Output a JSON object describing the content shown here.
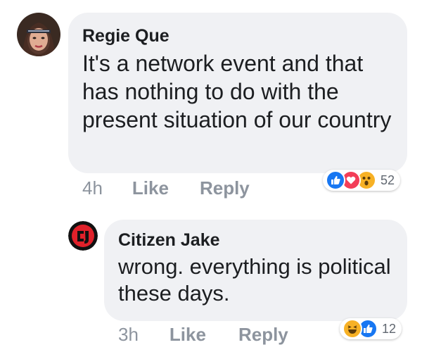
{
  "comments": [
    {
      "author": "Regie Que",
      "text": "It's a network event and  that has nothing to do with the present situation of our country",
      "time": "4h",
      "like_label": "Like",
      "reply_label": "Reply",
      "reactions": [
        "like-icon",
        "love-icon",
        "wow-icon"
      ],
      "reaction_count": "52"
    },
    {
      "author": "Citizen Jake",
      "text": "wrong. everything is political these days.",
      "time": "3h",
      "like_label": "Like",
      "reply_label": "Reply",
      "reactions": [
        "haha-icon",
        "like-icon"
      ],
      "reaction_count": "12"
    }
  ],
  "colors": {
    "bubble": "#f0f1f4",
    "text": "#1c1e21",
    "muted": "#8d949e",
    "like_blue": "#1877f2",
    "love_red": "#f33e58",
    "emoji_yellow": "#f7b125"
  }
}
